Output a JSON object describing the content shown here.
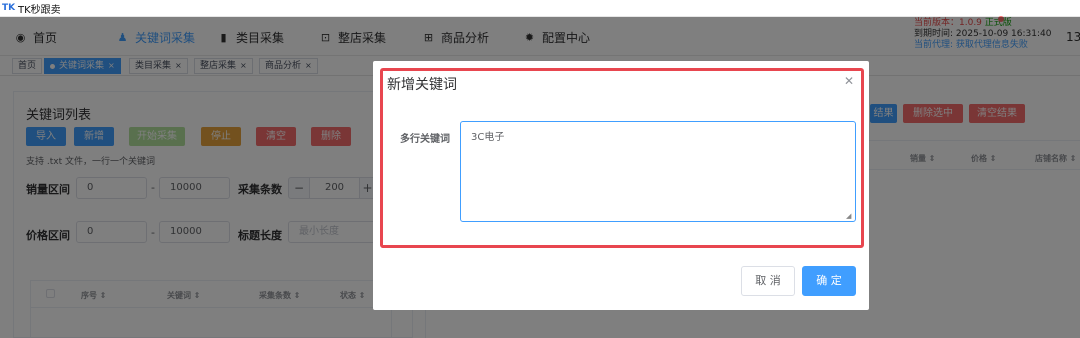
{
  "app": {
    "title": "TK秒跟卖"
  },
  "nav": {
    "items": [
      {
        "label": "首页",
        "icon": "dashboard-icon"
      },
      {
        "label": "关键词采集",
        "icon": "user-tie-icon",
        "active": true
      },
      {
        "label": "类目采集",
        "icon": "book-icon"
      },
      {
        "label": "整店采集",
        "icon": "shop-bag-icon"
      },
      {
        "label": "商品分析",
        "icon": "analysis-icon"
      },
      {
        "label": "配置中心",
        "icon": "gear-icon"
      }
    ],
    "version_text": "当前版本：1.0.9",
    "version_status": "正式版",
    "expire_text": "到期时间: 2025-10-09 16:31:40",
    "agent_text": "当前代理: 获取代理信息失败",
    "trail_text": "13"
  },
  "tabs": [
    {
      "label": "首页"
    },
    {
      "label": "关键词采集",
      "active": true
    },
    {
      "label": "类目采集"
    },
    {
      "label": "整店采集"
    },
    {
      "label": "商品分析"
    }
  ],
  "keyword_panel": {
    "title": "关键词列表",
    "buttons": {
      "import": "导入",
      "add": "新增",
      "start": "开始采集",
      "stop": "停止",
      "clear": "清空",
      "delete": "删除"
    },
    "hint": "支持 .txt 文件，一行一个关键词",
    "sales_range_label": "销量区间",
    "sales_min": "0",
    "sales_max": "10000",
    "collect_count_label": "采集条数",
    "collect_count": "200",
    "price_range_label": "价格区间",
    "price_min": "0",
    "price_max": "10000",
    "title_length_label": "标题长度",
    "title_length_placeholder": "最小长度",
    "table_headers": [
      "序号",
      "关键词",
      "采集条数",
      "状态"
    ]
  },
  "result_panel": {
    "buttons": {
      "result": "结果",
      "delete_selected": "删除选中",
      "clear_results": "清空结果"
    },
    "table_headers": [
      "销量",
      "价格",
      "店铺名称"
    ]
  },
  "dialog": {
    "title": "新增关键词",
    "field_label": "多行关键词",
    "textarea_value": "3C电子",
    "cancel": "取 消",
    "confirm": "确 定"
  },
  "colors": {
    "primary": "#409eff",
    "success": "#67c23a",
    "warning": "#e6a23c",
    "danger": "#f56c6c",
    "highlight_border": "#e8464f"
  }
}
